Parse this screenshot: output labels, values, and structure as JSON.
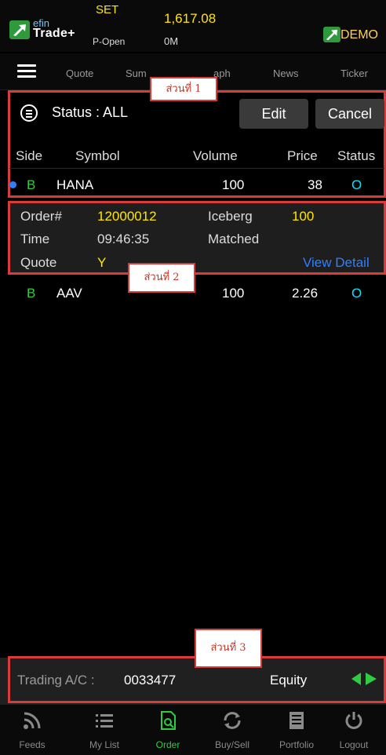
{
  "header": {
    "logo_small": "efin",
    "logo_main": "Trade+",
    "market_name": "SET",
    "market_status": "P-Open",
    "market_index": "1,617.08",
    "market_volume": "0M",
    "demo_label": "DEMO"
  },
  "tabs": [
    {
      "label": "Quote"
    },
    {
      "label": "Sum"
    },
    {
      "label": "aph"
    },
    {
      "label": "News"
    },
    {
      "label": "Ticker"
    }
  ],
  "annotations": {
    "section1": "ส่วนที่ 1",
    "section2": "ส่วนที่ 2",
    "section3": "ส่วนที่ 3"
  },
  "filter": {
    "status_label": "Status : ALL",
    "edit_label": "Edit",
    "cancel_label": "Cancel"
  },
  "table": {
    "headers": [
      "Side",
      "Symbol",
      "Volume",
      "Price",
      "Status"
    ],
    "rows": [
      {
        "side": "B",
        "symbol": "HANA",
        "volume": "100",
        "price": "38",
        "status": "O"
      },
      {
        "side": "B",
        "symbol": "AAV",
        "volume": "100",
        "price": "2.26",
        "status": "O"
      }
    ]
  },
  "detail": {
    "order_label": "Order#",
    "order_value": "12000012",
    "iceberg_label": "Iceberg",
    "iceberg_value": "100",
    "time_label": "Time",
    "time_value": "09:46:35",
    "matched_label": "Matched",
    "quote_label": "Quote",
    "quote_value": "Y",
    "view_detail_label": "View Detail"
  },
  "account": {
    "label": "Trading A/C :",
    "number": "0033477",
    "type": "Equity"
  },
  "bottom_nav": [
    {
      "label": "Feeds",
      "icon": "feeds-icon"
    },
    {
      "label": "My List",
      "icon": "list-icon"
    },
    {
      "label": "Order",
      "icon": "order-icon"
    },
    {
      "label": "Buy/Sell",
      "icon": "buysell-icon"
    },
    {
      "label": "Portfolio",
      "icon": "portfolio-icon"
    },
    {
      "label": "Logout",
      "icon": "power-icon"
    }
  ],
  "colors": {
    "accent_green": "#2ecc40",
    "status_cyan": "#00e5ff",
    "value_yellow": "#ffe600",
    "link_blue": "#2f80ff",
    "annotation_red": "#d93a3a"
  }
}
